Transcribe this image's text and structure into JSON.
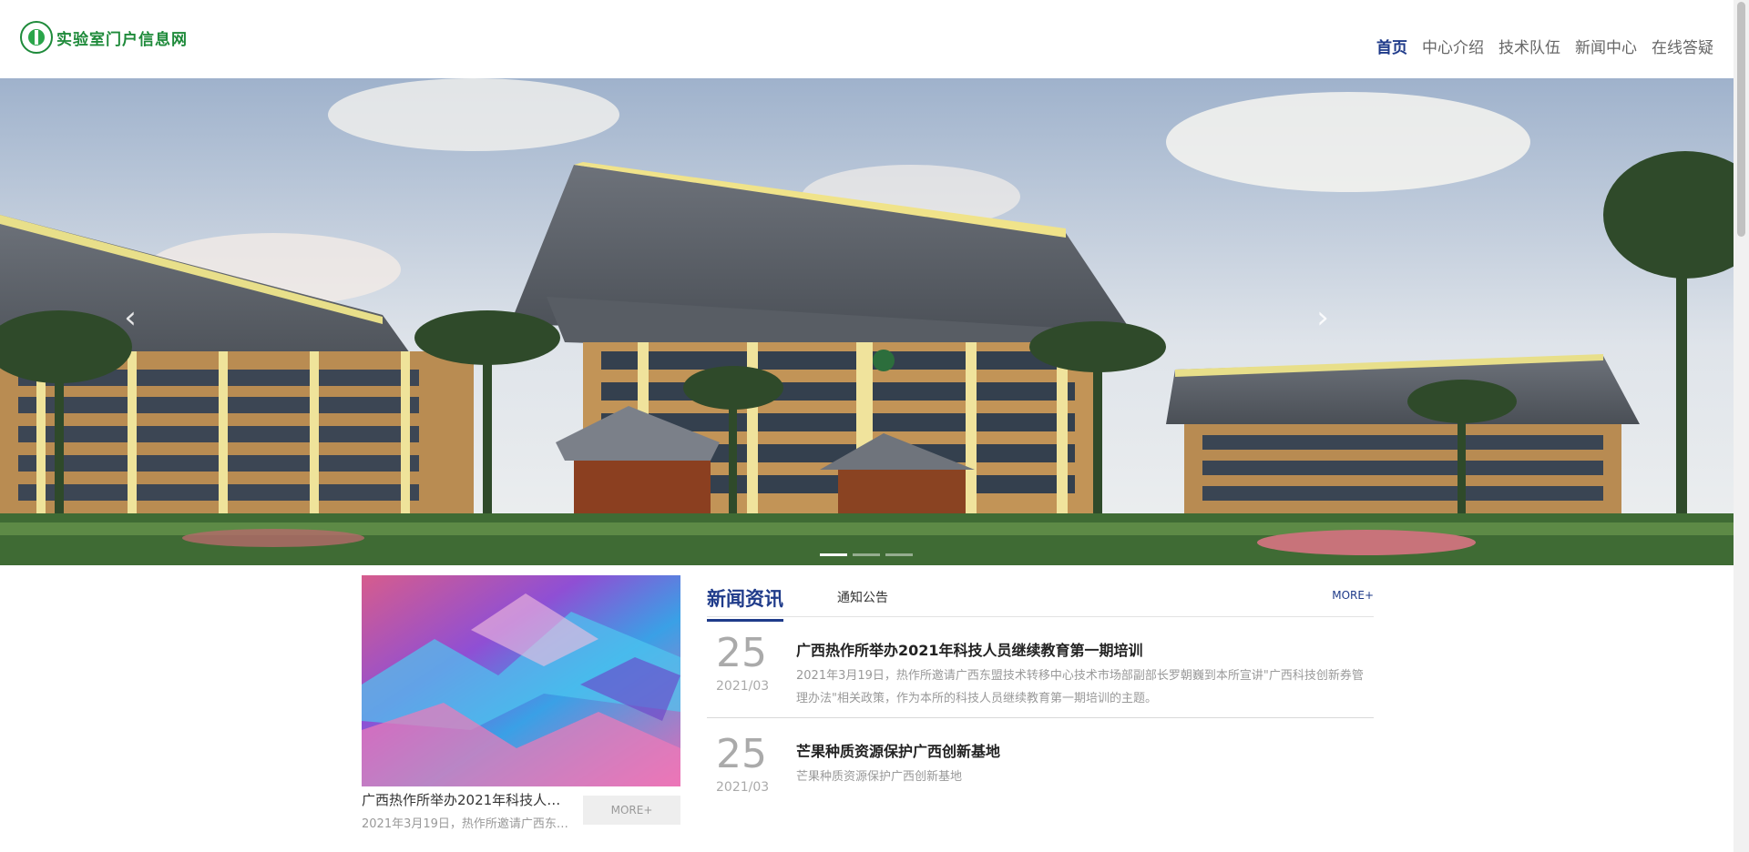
{
  "header": {
    "logo_text": "实验室门户信息网",
    "nav": [
      {
        "label": "首页",
        "active": true
      },
      {
        "label": "中心介绍",
        "active": false
      },
      {
        "label": "技术队伍",
        "active": false
      },
      {
        "label": "新闻中心",
        "active": false
      },
      {
        "label": "在线答疑",
        "active": false
      }
    ]
  },
  "banner": {
    "prev_icon": "chevron-left-icon",
    "next_icon": "chevron-right-icon",
    "slide_count": 3,
    "active_slide": 0
  },
  "feature": {
    "title": "广西热作所举办2021年科技人员继续教育第一期培训",
    "desc": "2021年3月19日，热作所邀请广西东盟技术转移中心技术市场部副部长罗朝巍到本所宣讲",
    "more_label": "MORE+"
  },
  "news": {
    "tab_news": "新闻资讯",
    "tab_notice": "通知公告",
    "more_label": "MORE+",
    "items": [
      {
        "day": "25",
        "ym": "2021/03",
        "title": "广西热作所举办2021年科技人员继续教育第一期培训",
        "desc": "2021年3月19日，热作所邀请广西东盟技术转移中心技术市场部副部长罗朝巍到本所宣讲\"广西科技创新券管理办法\"相关政策，作为本所的科技人员继续教育第一期培训的主题。"
      },
      {
        "day": "25",
        "ym": "2021/03",
        "title": "芒果种质资源保护广西创新基地",
        "desc": "芒果种质资源保护广西创新基地"
      }
    ]
  },
  "colors": {
    "accent": "#1f3b8a",
    "brand_green": "#1e8a3a"
  }
}
